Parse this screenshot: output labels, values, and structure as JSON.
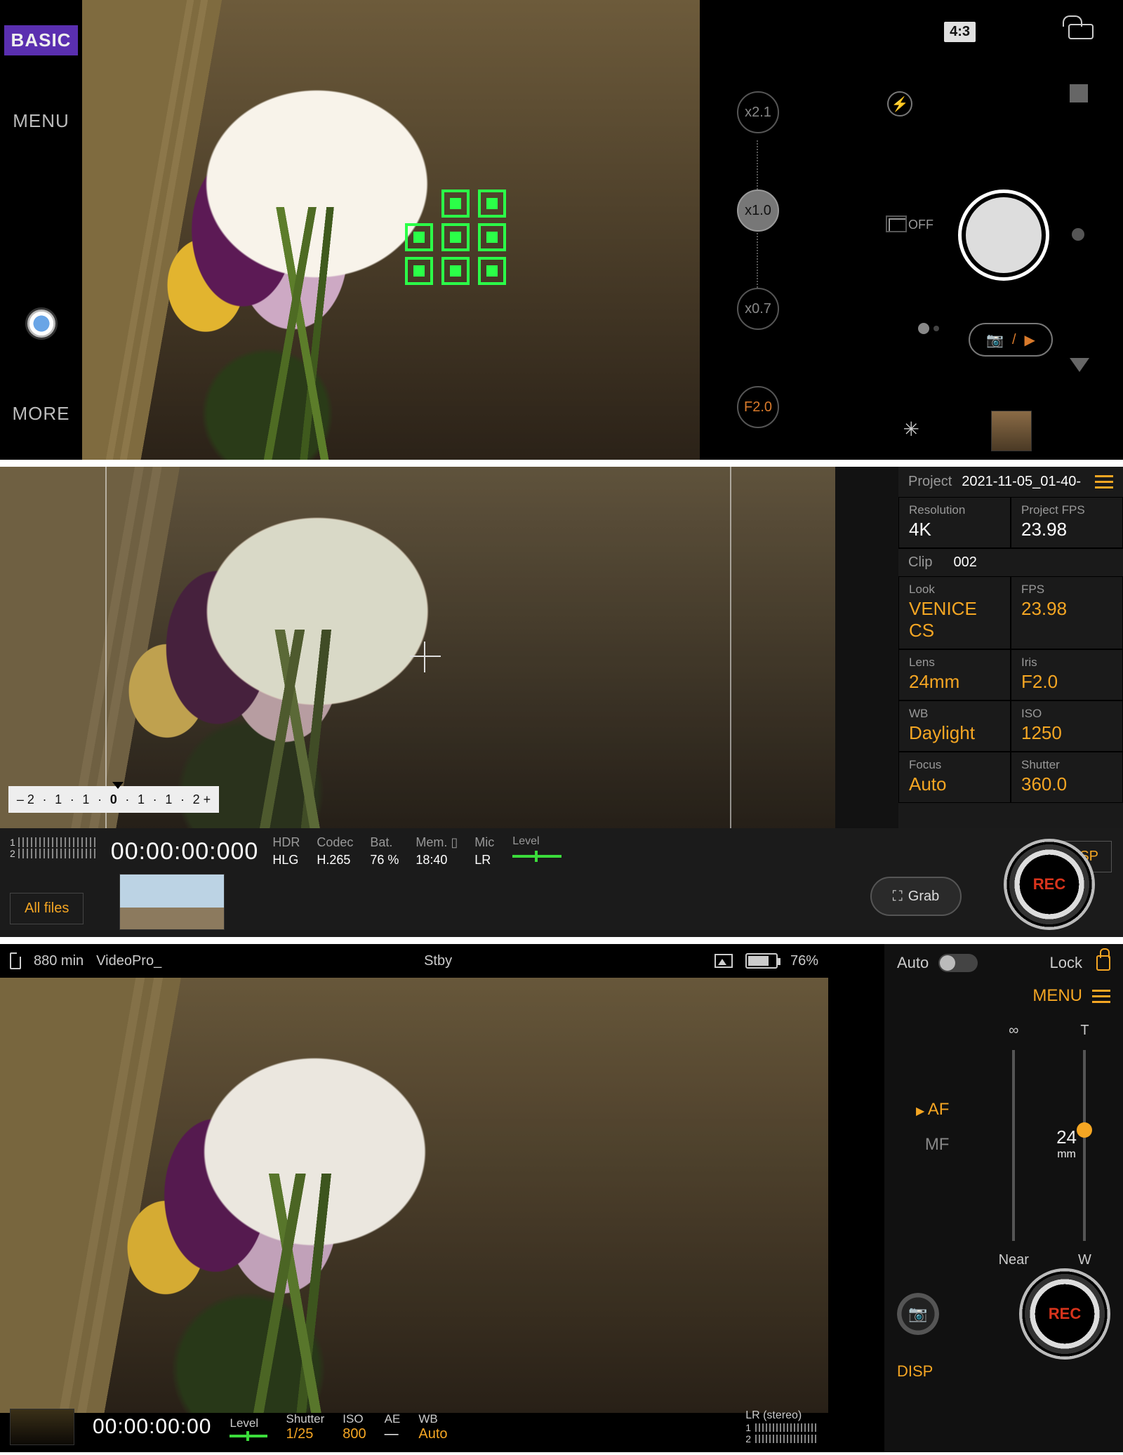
{
  "basic": {
    "mode_badge": "BASIC",
    "menu": "MENU",
    "more": "MORE",
    "aspect": "4:3",
    "drive_suffix": "OFF",
    "mode_toggle": {
      "photo_glyph": "📷",
      "sep": "/",
      "video_glyph": "▶"
    },
    "zoom": [
      "x2.1",
      "x1.0",
      "x0.7",
      "F2.0"
    ],
    "zoom_selected_index": 1
  },
  "cine": {
    "project_label": "Project",
    "project_name": "2021-11-05_01-40-",
    "clip_label": "Clip",
    "clip_no": "002",
    "rows": [
      {
        "lbl": "Resolution",
        "val": "4K",
        "y": false
      },
      {
        "lbl": "Project FPS",
        "val": "23.98",
        "y": false
      },
      {
        "lbl": "Look",
        "val": "VENICE CS",
        "y": true
      },
      {
        "lbl": "FPS",
        "val": "23.98",
        "y": true
      },
      {
        "lbl": "Lens",
        "val": "24mm",
        "y": true
      },
      {
        "lbl": "Iris",
        "val": "F2.0",
        "y": true
      },
      {
        "lbl": "WB",
        "val": "Daylight",
        "y": true
      },
      {
        "lbl": "ISO",
        "val": "1250",
        "y": true
      },
      {
        "lbl": "Focus",
        "val": "Auto",
        "y": true
      },
      {
        "lbl": "Shutter",
        "val": "360.0",
        "y": true
      }
    ],
    "audio_ch": [
      "1",
      "2"
    ],
    "tc": "00:00:00:000",
    "stats": [
      {
        "l": "HDR",
        "v": "HLG"
      },
      {
        "l": "Codec",
        "v": "H.265"
      },
      {
        "l": "Bat.",
        "v": "76 %"
      },
      {
        "l": "Mem. ▯",
        "v": "18:40"
      },
      {
        "l": "Mic",
        "v": "LR"
      }
    ],
    "level": "Level",
    "disp": "DISP",
    "all_files": "All files",
    "grab": "Grab",
    "rec": "REC",
    "ev_marks": [
      "– 2",
      "1",
      "1",
      "0",
      "1",
      "1",
      "2 +"
    ]
  },
  "vpro": {
    "storage_min": "880 min",
    "prefix": "VideoPro_",
    "state": "Stby",
    "batt": "76%",
    "tc": "00:00:00:00",
    "osd": [
      {
        "l": "Level",
        "v": "",
        "kind": "level"
      },
      {
        "l": "Shutter",
        "v": "1/25",
        "kind": "o"
      },
      {
        "l": "ISO",
        "v": "800",
        "kind": "o"
      },
      {
        "l": "AE",
        "v": "—",
        "kind": "w"
      },
      {
        "l": "WB",
        "v": "Auto",
        "kind": "o"
      }
    ],
    "lr_label": "LR (stereo)",
    "lr_ch": [
      "1",
      "2"
    ],
    "side": {
      "auto": "Auto",
      "lock": "Lock",
      "menu": "MENU",
      "focus_top": "∞",
      "focus_bottom": "Near",
      "zoom_top": "T",
      "zoom_bottom": "W",
      "zoom_val": "24",
      "zoom_unit": "mm",
      "af": "AF",
      "mf": "MF",
      "disp": "DISP",
      "rec": "REC"
    }
  }
}
